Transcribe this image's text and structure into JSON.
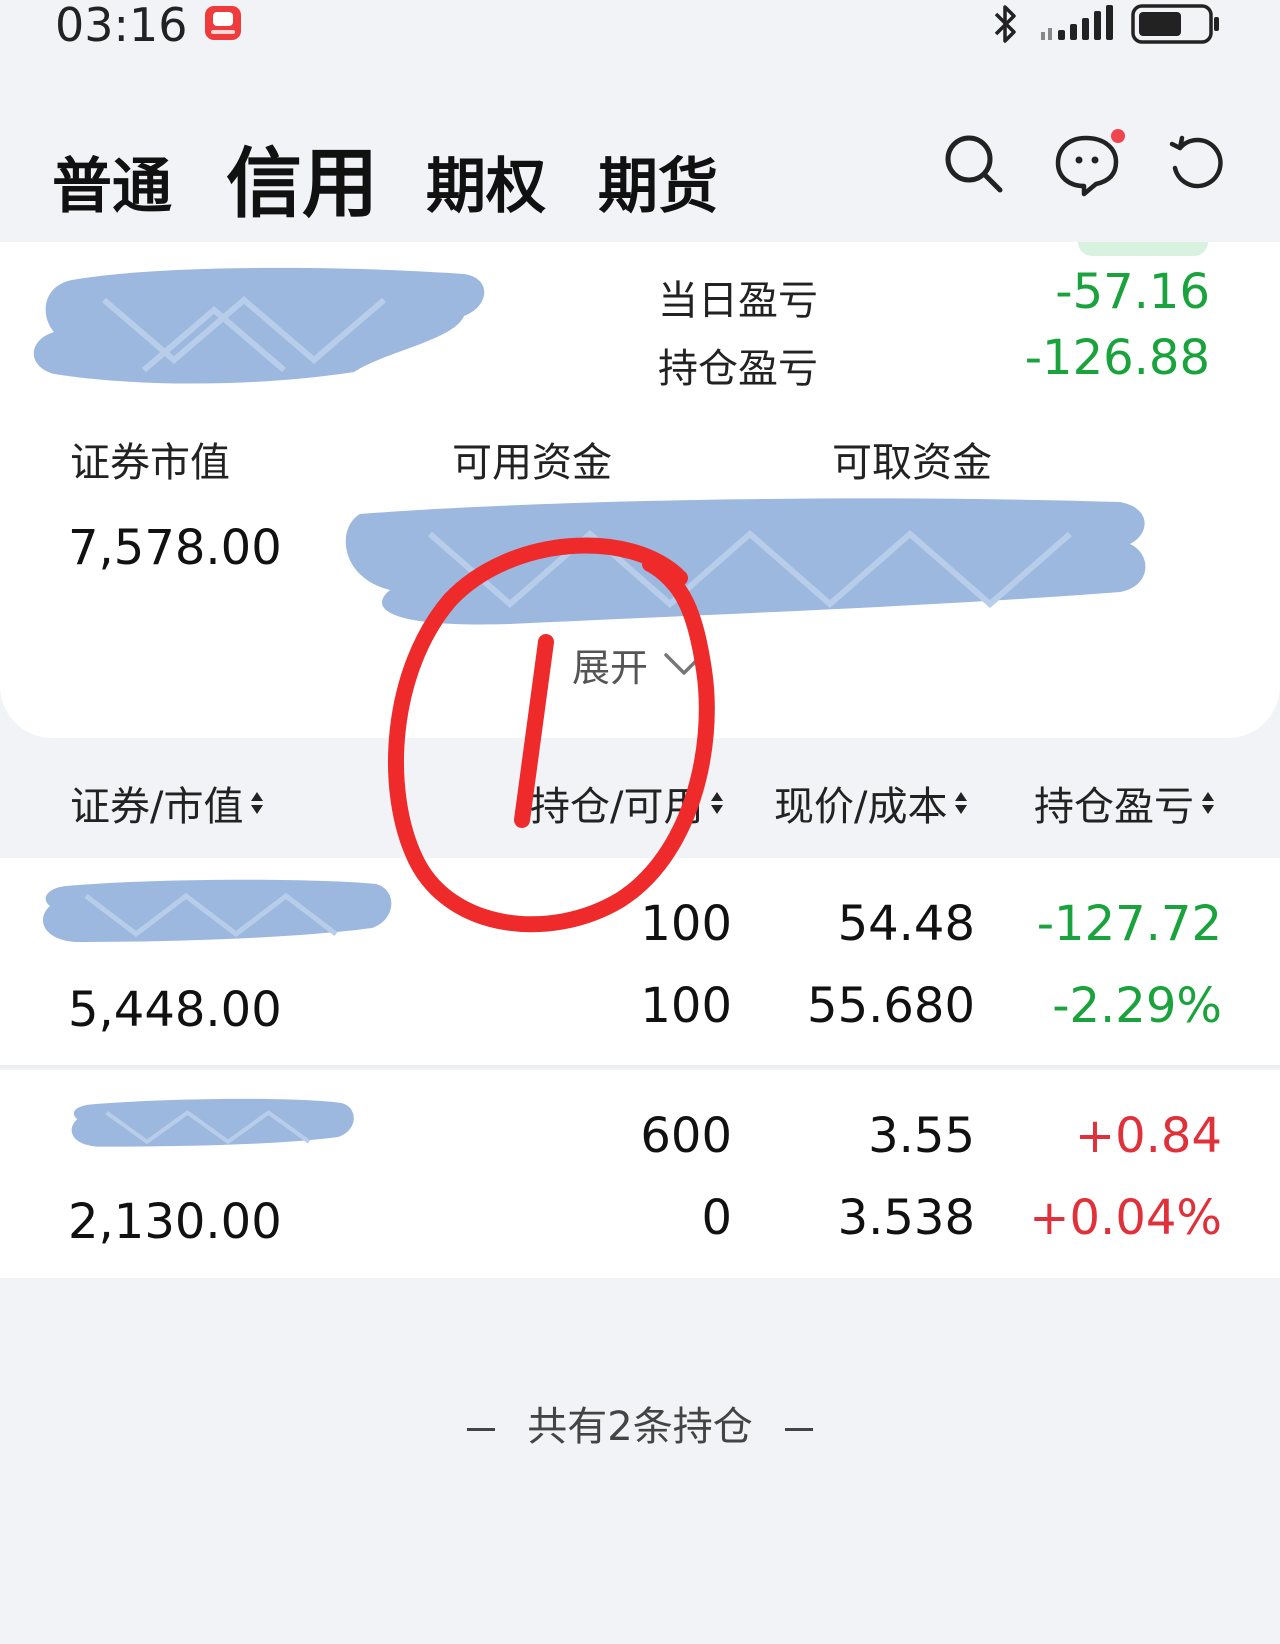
{
  "status_bar": {
    "time": "03:16",
    "icons": [
      "app-badge-icon",
      "bluetooth-icon",
      "signal-icon",
      "battery-icon"
    ]
  },
  "header": {
    "tabs": [
      {
        "label": "普通",
        "active": false
      },
      {
        "label": "信用",
        "active": true
      },
      {
        "label": "期权",
        "active": false
      },
      {
        "label": "期货",
        "active": false
      }
    ],
    "icons": [
      "search-icon",
      "chat-icon",
      "refresh-icon"
    ],
    "chat_badge_color": "#f0444e"
  },
  "account": {
    "daily_pl_label": "当日盈亏",
    "daily_pl_value": "-57.16",
    "position_pl_label": "持仓盈亏",
    "position_pl_value": "-126.88",
    "metrics": [
      {
        "label": "证券市值",
        "value": "7,578.00"
      },
      {
        "label": "可用资金"
      },
      {
        "label": "可取资金"
      }
    ],
    "expand_label": "展开"
  },
  "table": {
    "headers": [
      "证券/市值",
      "持仓/可用",
      "现价/成本",
      "持仓盈亏"
    ],
    "rows": [
      {
        "market_value": "5,448.00",
        "position": "100",
        "available": "100",
        "price": "54.48",
        "cost": "55.680",
        "pl": "-127.72",
        "pl_pct": "-2.29%",
        "trend": "down"
      },
      {
        "market_value": "2,130.00",
        "position": "600",
        "available": "0",
        "price": "3.55",
        "cost": "3.538",
        "pl": "+0.84",
        "pl_pct": "+0.04%",
        "trend": "up"
      }
    ]
  },
  "footer": {
    "note": "共有2条持仓"
  },
  "colors": {
    "gain": "#e0303a",
    "loss": "#1aa33c",
    "background": "#f2f3f6",
    "card": "#ffffff",
    "redaction": "#9cb8de",
    "markup": "#ee2a2a"
  }
}
